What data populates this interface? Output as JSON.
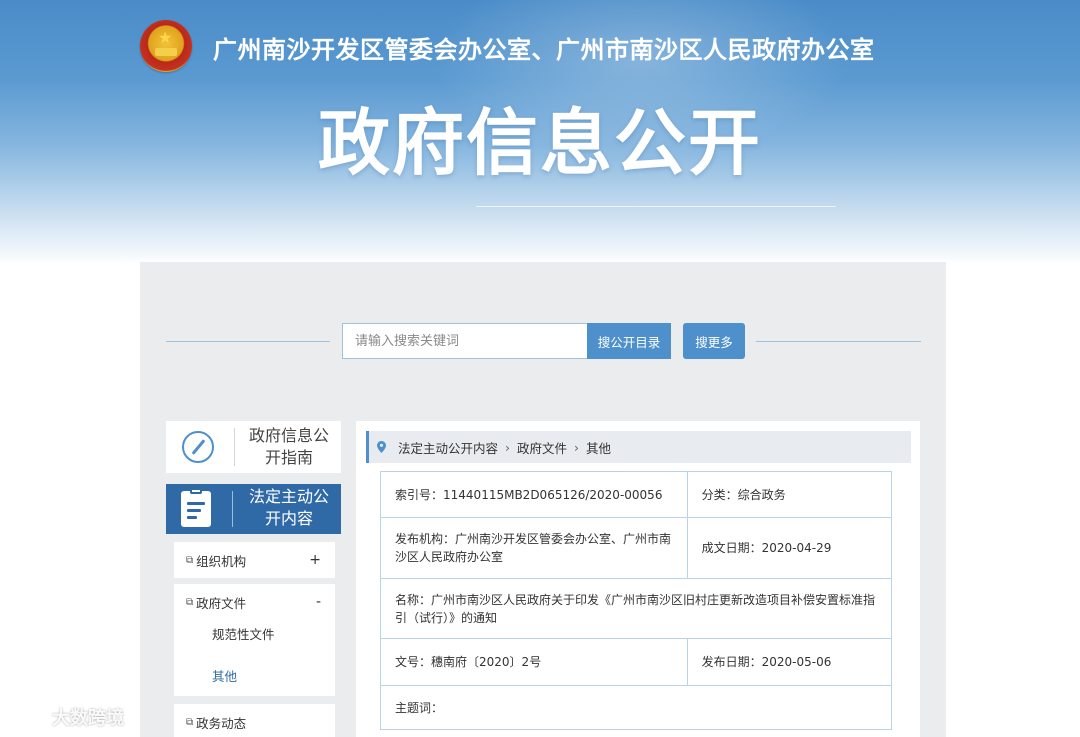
{
  "header": {
    "org_title": "广州南沙开发区管委会办公室、广州市南沙区人民政府办公室",
    "main_title": "政府信息公开",
    "emblem_icon": "national-emblem"
  },
  "search": {
    "placeholder": "请输入搜索关键词",
    "value": "",
    "catalog_button": "搜公开目录",
    "more_button": "搜更多"
  },
  "sidebar": {
    "guide_label": "政府信息公开指南",
    "guide_icon": "compass-icon",
    "active_label": "法定主动公开内容",
    "active_icon": "document-icon",
    "items": [
      {
        "label": "组织机构",
        "sign": "+"
      },
      {
        "label": "政府文件",
        "sign": "-",
        "children": [
          "规范性文件",
          "其他"
        ]
      },
      {
        "label": "政务动态"
      }
    ]
  },
  "breadcrumb": [
    "法定主动公开内容",
    "政府文件",
    "其他"
  ],
  "meta": {
    "index_label": "索引号：",
    "index_value": "11440115MB2D065126/2020-00056",
    "category_label": "分类：",
    "category_value": "综合政务",
    "publisher_label": "发布机构：",
    "publisher_value": "广州南沙开发区管委会办公室、广州市南沙区人民政府办公室",
    "created_label": "成文日期：",
    "created_value": "2020-04-29",
    "name_label": "名称：",
    "name_value": "广州市南沙区人民政府关于印发《广州市南沙区旧村庄更新改造项目补偿安置标准指引（试行）》的通知",
    "doc_no_label": "文号：",
    "doc_no_value": "穗南府〔2020〕2号",
    "publish_label": "发布日期：",
    "publish_value": "2020-05-06",
    "subject_label": "主题词：",
    "subject_value": ""
  },
  "watermark": "大数跨境",
  "colors": {
    "accent": "#4d90cc",
    "active_nav": "#2f6aa6",
    "panel_bg": "#ebeced",
    "table_border": "#b9d3ea"
  }
}
